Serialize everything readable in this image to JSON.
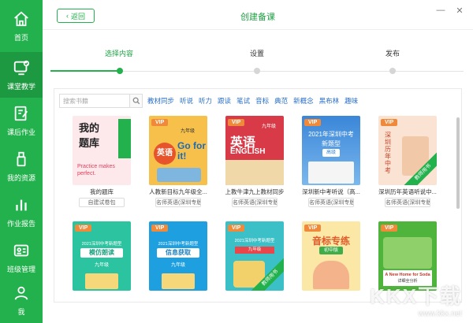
{
  "sidebar": {
    "items": [
      {
        "label": "首页",
        "icon": "home-icon"
      },
      {
        "label": "课堂教学",
        "icon": "classroom-icon"
      },
      {
        "label": "课后作业",
        "icon": "homework-icon"
      },
      {
        "label": "我的资源",
        "icon": "usb-drive-icon"
      },
      {
        "label": "作业报告",
        "icon": "bar-chart-icon"
      },
      {
        "label": "班级管理",
        "icon": "id-card-icon"
      },
      {
        "label": "我",
        "icon": "user-icon"
      }
    ],
    "active_index": 1,
    "color": "#22b14c"
  },
  "header": {
    "back_label": "返回",
    "title": "创建备课"
  },
  "steps": [
    {
      "label": "选择内容",
      "active": true
    },
    {
      "label": "设置",
      "active": false
    },
    {
      "label": "发布",
      "active": false
    }
  ],
  "search": {
    "placeholder": "搜索书籍"
  },
  "filters": [
    "教材同步",
    "听说",
    "听力",
    "跟读",
    "笔试",
    "音标",
    "典范",
    "新概念",
    "黑布林",
    "趣味"
  ],
  "books_row1": [
    {
      "title": "我的题库",
      "badge": "自建试卷包",
      "cover_lines": [
        "我的",
        "题库",
        "Practice makes perfect."
      ],
      "vip": false
    },
    {
      "title": "人教新目标九年级全...",
      "badge": "名师英语(深圳专版)",
      "cover_lines": [
        "英语",
        "Go for it!",
        "九年级"
      ],
      "vip": true
    },
    {
      "title": "上教牛津九上教材同步",
      "badge": "名师英语(深圳专版)",
      "cover_lines": [
        "英语",
        "ENGLISH",
        "九年级"
      ],
      "vip": true
    },
    {
      "title": "深圳新中考听说（高...",
      "badge": "名师英语(深圳专版)",
      "cover_lines": [
        "2021年深圳中考",
        "新题型",
        "高级"
      ],
      "vip": true
    },
    {
      "title": "深圳历年英语听说中...",
      "badge": "名师英语(深圳专版)",
      "cover_lines": [
        "深圳历年中考",
        "教师用书"
      ],
      "vip": true
    }
  ],
  "books_row2": [
    {
      "cover_lines": [
        "2021深圳中考新题型",
        "模仿朗读",
        "九年级"
      ],
      "vip": true
    },
    {
      "cover_lines": [
        "2021深圳中考新题型",
        "信息获取",
        "九年级"
      ],
      "vip": true
    },
    {
      "cover_lines": [
        "2021深圳中考新题型",
        "九年级",
        "教师用书"
      ],
      "vip": true
    },
    {
      "cover_lines": [
        "音标专练",
        "初中版"
      ],
      "vip": true
    },
    {
      "cover_lines": [
        "A New Home for Soda",
        "详细全分析"
      ],
      "vip": true
    }
  ],
  "watermark": {
    "big": "KKX下载",
    "small": "www.kkx.net"
  }
}
